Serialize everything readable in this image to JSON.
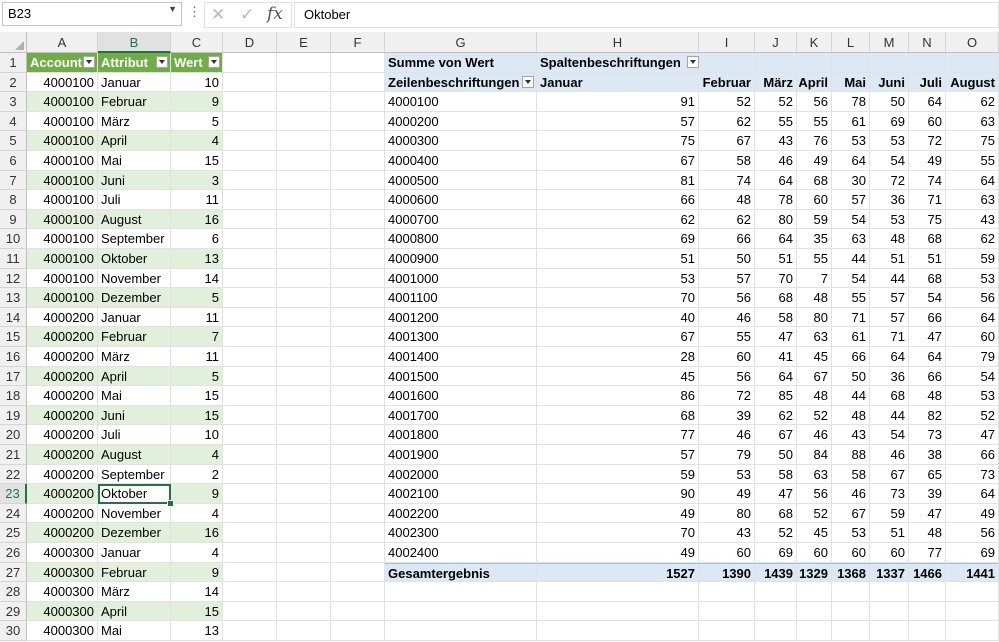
{
  "formula_bar": {
    "name_box": "B23",
    "formula": "Oktober",
    "cancel_icon": "close-icon",
    "enter_icon": "check-icon",
    "fx_label": "fx"
  },
  "columns": [
    "A",
    "B",
    "C",
    "D",
    "E",
    "F",
    "G",
    "H",
    "I",
    "J",
    "K",
    "L",
    "M",
    "N",
    "O"
  ],
  "selected": {
    "column": "B",
    "row": 23
  },
  "table": {
    "headers": [
      "Account",
      "Attribut",
      "Wert"
    ],
    "rows": [
      [
        "4000100",
        "Januar",
        "10"
      ],
      [
        "4000100",
        "Februar",
        "9"
      ],
      [
        "4000100",
        "März",
        "5"
      ],
      [
        "4000100",
        "April",
        "4"
      ],
      [
        "4000100",
        "Mai",
        "15"
      ],
      [
        "4000100",
        "Juni",
        "3"
      ],
      [
        "4000100",
        "Juli",
        "11"
      ],
      [
        "4000100",
        "August",
        "16"
      ],
      [
        "4000100",
        "September",
        "6"
      ],
      [
        "4000100",
        "Oktober",
        "13"
      ],
      [
        "4000100",
        "November",
        "14"
      ],
      [
        "4000100",
        "Dezember",
        "5"
      ],
      [
        "4000200",
        "Januar",
        "11"
      ],
      [
        "4000200",
        "Februar",
        "7"
      ],
      [
        "4000200",
        "März",
        "11"
      ],
      [
        "4000200",
        "April",
        "5"
      ],
      [
        "4000200",
        "Mai",
        "15"
      ],
      [
        "4000200",
        "Juni",
        "15"
      ],
      [
        "4000200",
        "Juli",
        "10"
      ],
      [
        "4000200",
        "August",
        "4"
      ],
      [
        "4000200",
        "September",
        "2"
      ],
      [
        "4000200",
        "Oktober",
        "9"
      ],
      [
        "4000200",
        "November",
        "4"
      ],
      [
        "4000200",
        "Dezember",
        "16"
      ],
      [
        "4000300",
        "Januar",
        "4"
      ],
      [
        "4000300",
        "Februar",
        "9"
      ],
      [
        "4000300",
        "März",
        "14"
      ],
      [
        "4000300",
        "April",
        "15"
      ],
      [
        "4000300",
        "Mai",
        "13"
      ]
    ]
  },
  "pivot": {
    "values_label": "Summe von Wert",
    "columns_label": "Spaltenbeschriftungen",
    "rows_label": "Zeilenbeschriftungen",
    "months": [
      "Januar",
      "Februar",
      "März",
      "April",
      "Mai",
      "Juni",
      "Juli",
      "August"
    ],
    "rows": [
      {
        "label": "4000100",
        "values": [
          "91",
          "52",
          "52",
          "56",
          "78",
          "50",
          "64",
          "62"
        ]
      },
      {
        "label": "4000200",
        "values": [
          "57",
          "62",
          "55",
          "55",
          "61",
          "69",
          "60",
          "63"
        ]
      },
      {
        "label": "4000300",
        "values": [
          "75",
          "67",
          "43",
          "76",
          "53",
          "53",
          "72",
          "75"
        ]
      },
      {
        "label": "4000400",
        "values": [
          "67",
          "58",
          "46",
          "49",
          "64",
          "54",
          "49",
          "55"
        ]
      },
      {
        "label": "4000500",
        "values": [
          "81",
          "74",
          "64",
          "68",
          "30",
          "72",
          "74",
          "64"
        ]
      },
      {
        "label": "4000600",
        "values": [
          "66",
          "48",
          "78",
          "60",
          "57",
          "36",
          "71",
          "63"
        ]
      },
      {
        "label": "4000700",
        "values": [
          "62",
          "62",
          "80",
          "59",
          "54",
          "53",
          "75",
          "43"
        ]
      },
      {
        "label": "4000800",
        "values": [
          "69",
          "66",
          "64",
          "35",
          "63",
          "48",
          "68",
          "62"
        ]
      },
      {
        "label": "4000900",
        "values": [
          "51",
          "50",
          "51",
          "55",
          "44",
          "51",
          "51",
          "59"
        ]
      },
      {
        "label": "4001000",
        "values": [
          "53",
          "57",
          "70",
          "7",
          "54",
          "44",
          "68",
          "53"
        ]
      },
      {
        "label": "4001100",
        "values": [
          "70",
          "56",
          "68",
          "48",
          "55",
          "57",
          "54",
          "56"
        ]
      },
      {
        "label": "4001200",
        "values": [
          "40",
          "46",
          "58",
          "80",
          "71",
          "57",
          "66",
          "64"
        ]
      },
      {
        "label": "4001300",
        "values": [
          "67",
          "55",
          "47",
          "63",
          "61",
          "71",
          "47",
          "60"
        ]
      },
      {
        "label": "4001400",
        "values": [
          "28",
          "60",
          "41",
          "45",
          "66",
          "64",
          "64",
          "79"
        ]
      },
      {
        "label": "4001500",
        "values": [
          "45",
          "56",
          "64",
          "67",
          "50",
          "36",
          "66",
          "54"
        ]
      },
      {
        "label": "4001600",
        "values": [
          "86",
          "72",
          "85",
          "48",
          "44",
          "68",
          "48",
          "53"
        ]
      },
      {
        "label": "4001700",
        "values": [
          "68",
          "39",
          "62",
          "52",
          "48",
          "44",
          "82",
          "52"
        ]
      },
      {
        "label": "4001800",
        "values": [
          "77",
          "46",
          "67",
          "46",
          "43",
          "54",
          "73",
          "47"
        ]
      },
      {
        "label": "4001900",
        "values": [
          "57",
          "79",
          "50",
          "84",
          "88",
          "46",
          "38",
          "66"
        ]
      },
      {
        "label": "4002000",
        "values": [
          "59",
          "53",
          "58",
          "63",
          "58",
          "67",
          "65",
          "73"
        ]
      },
      {
        "label": "4002100",
        "values": [
          "90",
          "49",
          "47",
          "56",
          "46",
          "73",
          "39",
          "64"
        ]
      },
      {
        "label": "4002200",
        "values": [
          "49",
          "80",
          "68",
          "52",
          "67",
          "59",
          "47",
          "49"
        ]
      },
      {
        "label": "4002300",
        "values": [
          "70",
          "43",
          "52",
          "45",
          "53",
          "51",
          "48",
          "56"
        ]
      },
      {
        "label": "4002400",
        "values": [
          "49",
          "60",
          "69",
          "60",
          "60",
          "60",
          "77",
          "69"
        ]
      }
    ],
    "total_label": "Gesamtergebnis",
    "totals": [
      "1527",
      "1390",
      "1439",
      "1329",
      "1368",
      "1337",
      "1466",
      "1441"
    ]
  },
  "colors": {
    "table_header": "#70ad47",
    "table_band": "#e2efda",
    "pivot_header": "#dce9f5",
    "selection": "#217346"
  }
}
